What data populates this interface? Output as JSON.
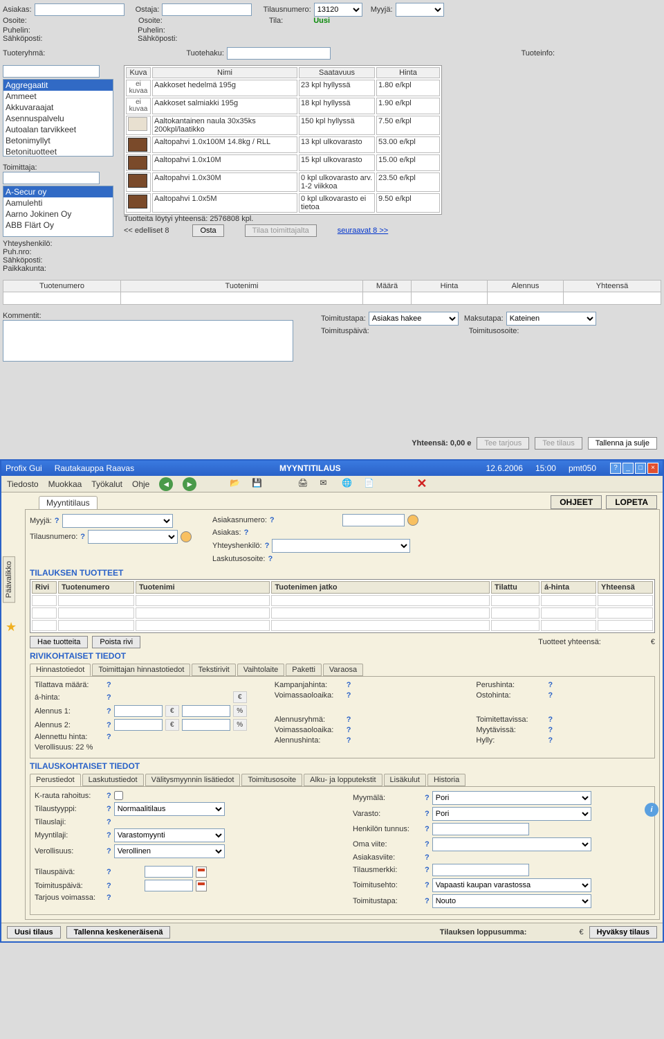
{
  "top": {
    "labels": {
      "asiakas": "Asiakas:",
      "ostaja": "Ostaja:",
      "tilausnumero": "Tilausnumero:",
      "myyja": "Myyjä:",
      "osoite": "Osoite:",
      "tila": "Tila:",
      "tila_value": "Uusi",
      "puhelin": "Puhelin:",
      "sahkoposti": "Sähköposti:",
      "tuoteryhma": "Tuoteryhmä:",
      "tuotehaku": "Tuotehaku:",
      "tuoteinfo": "Tuoteinfo:",
      "toimittaja": "Toimittaja:",
      "yhteyshenkilo": "Yhteyshenkilö:",
      "puhnro": "Puh.nro:",
      "paikkakunta": "Paikkakunta:",
      "tuotteita_loytyi": "Tuotteita löytyi yhteensä: 2576808 kpl.",
      "prev": "<< edelliset 8",
      "next": "seuraavat 8 >>",
      "osta": "Osta",
      "tilaa_toimittajalta": "Tilaa toimittajalta",
      "kommentit": "Kommentit:",
      "toimitustapa": "Toimitustapa:",
      "maksutapa": "Maksutapa:",
      "toimituspaiva": "Toimituspäivä:",
      "toimitusosoite": "Toimitusosoite:",
      "yhteensa": "Yhteensä: 0,00  e",
      "tee_tarjous": "Tee tarjous",
      "tee_tilaus": "Tee tilaus",
      "tallenna_sulje": "Tallenna ja sulje"
    },
    "tilausnumero_value": "13120",
    "tuoteryhmat": [
      "Aggregaatit",
      "Ammeet",
      "Akkuvaraajat",
      "Asennuspalvelu",
      "Autoalan tarvikkeet",
      "Betonimyllyt",
      "Betonituotteet"
    ],
    "toimittajat": [
      "A-Secur oy",
      "Aamulehti",
      "Aarno Jokinen Oy",
      "ABB Flärt Oy"
    ],
    "product_headers": {
      "kuva": "Kuva",
      "nimi": "Nimi",
      "saatavuus": "Saatavuus",
      "hinta": "Hinta"
    },
    "products": [
      {
        "img": "none",
        "nimi": "Aakkoset hedelmä 195g",
        "saat": "23 kpl hyllyssä",
        "hinta": "1.80 e/kpl"
      },
      {
        "img": "none",
        "nimi": "Aakkoset salmiakki 195g",
        "saat": "18 kpl hyllyssä",
        "hinta": "1.90 e/kpl"
      },
      {
        "img": "nail",
        "nimi": "Aaltokantainen naula 30x35ks 200kpl/laatikko",
        "saat": "150 kpl hyllyssä",
        "hinta": "7.50 e/kpl"
      },
      {
        "img": "brown",
        "nimi": "Aaltopahvi 1.0x100M 14.8kg / RLL",
        "saat": "13 kpl ulkovarasto",
        "hinta": "53.00 e/kpl"
      },
      {
        "img": "brown",
        "nimi": "Aaltopahvi 1.0x10M",
        "saat": "15 kpl ulkovarasto",
        "hinta": "15.00 e/kpl"
      },
      {
        "img": "brown",
        "nimi": "Aaltopahvi 1.0x30M",
        "saat": "0 kpl ulkovarasto arv. 1-2 viikkoa",
        "hinta": "23.50 e/kpl"
      },
      {
        "img": "brown",
        "nimi": "Aaltopahvi 1.0x5M",
        "saat": "0 kpl ulkovarasto ei tietoa",
        "hinta": "9.50 e/kpl"
      }
    ],
    "order_headers": [
      "Tuotenumero",
      "Tuotenimi",
      "Määrä",
      "Hinta",
      "Alennus",
      "Yhteensä"
    ],
    "toimitustapa_value": "Asiakas hakee",
    "maksutapa_value": "Kateinen"
  },
  "bottom": {
    "title": {
      "app": "Profix Gui",
      "company": "Rautakauppa Raavas",
      "screen": "MYYNTITILAUS",
      "date": "12.6.2006",
      "time": "15:00",
      "code": "pmt050"
    },
    "menu": [
      "Tiedosto",
      "Muokkaa",
      "Työkalut",
      "Ohje"
    ],
    "tab_main": "Myyntitilaus",
    "btn_ohjeet": "OHJEET",
    "btn_lopeta": "LOPETA",
    "head": {
      "myyja": "Myyjä:",
      "asiaknro": "Asiakasnumero:",
      "tilnro": "Tilausnumero:",
      "asiakas": "Asiakas:",
      "yhteys": "Yhteyshenkilö:",
      "laskutus": "Laskutusosoite:"
    },
    "section1": "TILAUKSEN TUOTTEET",
    "grid_headers": [
      "Rivi",
      "Tuotenumero",
      "Tuotenimi",
      "Tuotenimen jatko",
      "Tilattu",
      "á-hinta",
      "Yhteensä"
    ],
    "btn_hae": "Hae tuotteita",
    "btn_poista": "Poista rivi",
    "tuotteet_yht": "Tuotteet yhteensä:",
    "eur": "€",
    "section2": "RIVIKOHTAISET TIEDOT",
    "rivi_tabs": [
      "Hinnastotiedot",
      "Toimittajan hinnastotiedot",
      "Tekstirivit",
      "Vaihtolaite",
      "Paketti",
      "Varaosa"
    ],
    "rivi": {
      "tilattava": "Tilattava määrä:",
      "ahinta": "á-hinta:",
      "alennus1": "Alennus 1:",
      "alennus2": "Alennus 2:",
      "alennettu": "Alennettu hinta:",
      "verollisuus": "Verollisuus: 22 %",
      "kampanja": "Kampanjahinta:",
      "voimassa": "Voimassaoloaika:",
      "alennusryhma": "Alennusryhmä:",
      "alennushinta": "Alennushinta:",
      "perushinta": "Perushinta:",
      "ostohinta": "Ostohinta:",
      "toimitettavissa": "Toimitettavissa:",
      "myytavissa": "Myytävissä:",
      "hylly": "Hylly:"
    },
    "section3": "TILAUSKOHTAISET TIEDOT",
    "tilaus_tabs": [
      "Perustiedot",
      "Laskutustiedot",
      "Välitysmyynnin lisätiedot",
      "Toimitusosoite",
      "Alku- ja lopputekstit",
      "Lisäkulut",
      "Historia"
    ],
    "tilaus": {
      "krauta": "K-rauta rahoitus:",
      "tilaustyyppi": "Tilaustyyppi:",
      "tilauslaji": "Tilauslaji:",
      "myyntilaji": "Myyntilaji:",
      "verollisuus": "Verollisuus:",
      "tilauspaiva": "Tilauspäivä:",
      "toimituspaiva": "Toimituspäivä:",
      "tarjous": "Tarjous voimassa:",
      "myymala": "Myymälä:",
      "varasto": "Varasto:",
      "henkilo": "Henkilön tunnus:",
      "omaviite": "Oma viite:",
      "asiakviite": "Asiakasviite:",
      "tilausmerkki": "Tilausmerkki:",
      "toimitusehto": "Toimitusehto:",
      "toimitustapa": "Toimitustapa:",
      "val_tilaustyyppi": "Normaalitilaus",
      "val_myyntilaji": "Varastomyynti",
      "val_verollisuus": "Verollinen",
      "val_myymala": "Pori",
      "val_varasto": "Pori",
      "val_toimitusehto": "Vapaasti kaupan varastossa",
      "val_toimitustapa": "Nouto"
    },
    "footer": {
      "uusi": "Uusi tilaus",
      "tallenna": "Tallenna keskeneräisenä",
      "loppusumma": "Tilauksen loppusumma:",
      "hyvaksy": "Hyväksy tilaus"
    },
    "paav": "Päävalikko"
  }
}
